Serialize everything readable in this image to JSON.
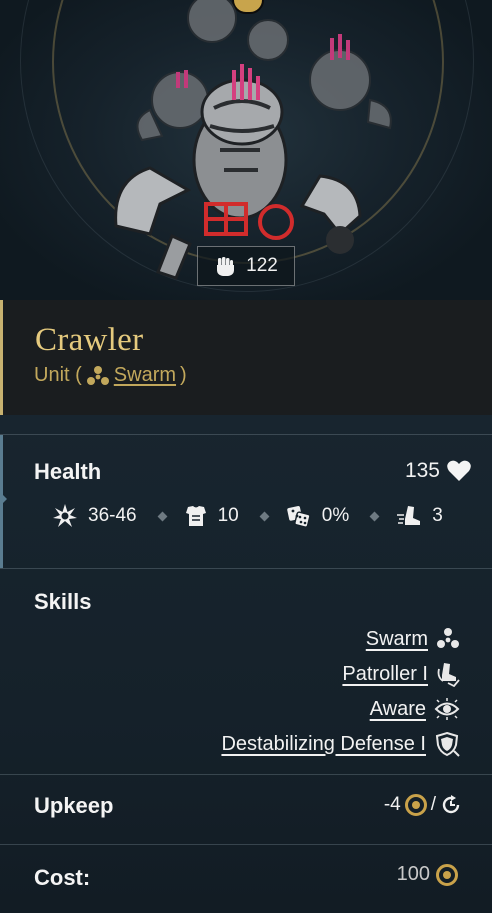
{
  "unit": {
    "power": "122",
    "name": "Crawler",
    "type_prefix": "Unit (",
    "faction": "Swarm",
    "type_suffix": ")"
  },
  "health": {
    "title": "Health",
    "value": "135"
  },
  "stats": [
    {
      "icon": "damage-burst-icon",
      "value": "36-46"
    },
    {
      "icon": "armor-icon",
      "value": "10"
    },
    {
      "icon": "dice-icon",
      "value": "0%"
    },
    {
      "icon": "movement-boot-icon",
      "value": "3"
    }
  ],
  "skills": {
    "title": "Skills",
    "items": [
      {
        "label": "Swarm",
        "icon": "swarm-icon"
      },
      {
        "label": "Patroller I",
        "icon": "patroller-icon"
      },
      {
        "label": "Aware",
        "icon": "eye-icon"
      },
      {
        "label": "Destabilizing Defense I",
        "icon": "shield-icon"
      }
    ]
  },
  "upkeep": {
    "title": "Upkeep",
    "value": "-4",
    "slash": "/"
  },
  "cost": {
    "title": "Cost:",
    "value": "100"
  },
  "colors": {
    "gold": "#c9a24a",
    "name_gold": "#e5ca7e",
    "panel_bg": "#15212a"
  }
}
